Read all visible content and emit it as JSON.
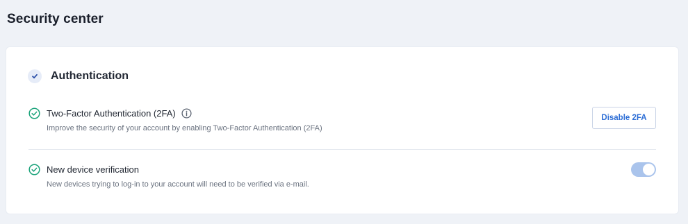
{
  "page": {
    "title": "Security center"
  },
  "section": {
    "title": "Authentication",
    "icon": "checkmark-icon"
  },
  "settings": [
    {
      "title": "Two-Factor Authentication (2FA)",
      "description": "Improve the security of your account by enabling Two-Factor Authentication (2FA)",
      "status_icon": "check-circle-icon",
      "info_icon": "info-icon",
      "action_label": "Disable 2FA"
    },
    {
      "title": "New device verification",
      "description": "New devices trying to log-in to your account will need to be verified via e-mail.",
      "status_icon": "check-circle-icon",
      "toggle_on": true
    }
  ],
  "colors": {
    "background": "#eff2f7",
    "card": "#ffffff",
    "success": "#1aa37a",
    "accent": "#2f6fd6",
    "toggle_on": "#aac4ec"
  }
}
